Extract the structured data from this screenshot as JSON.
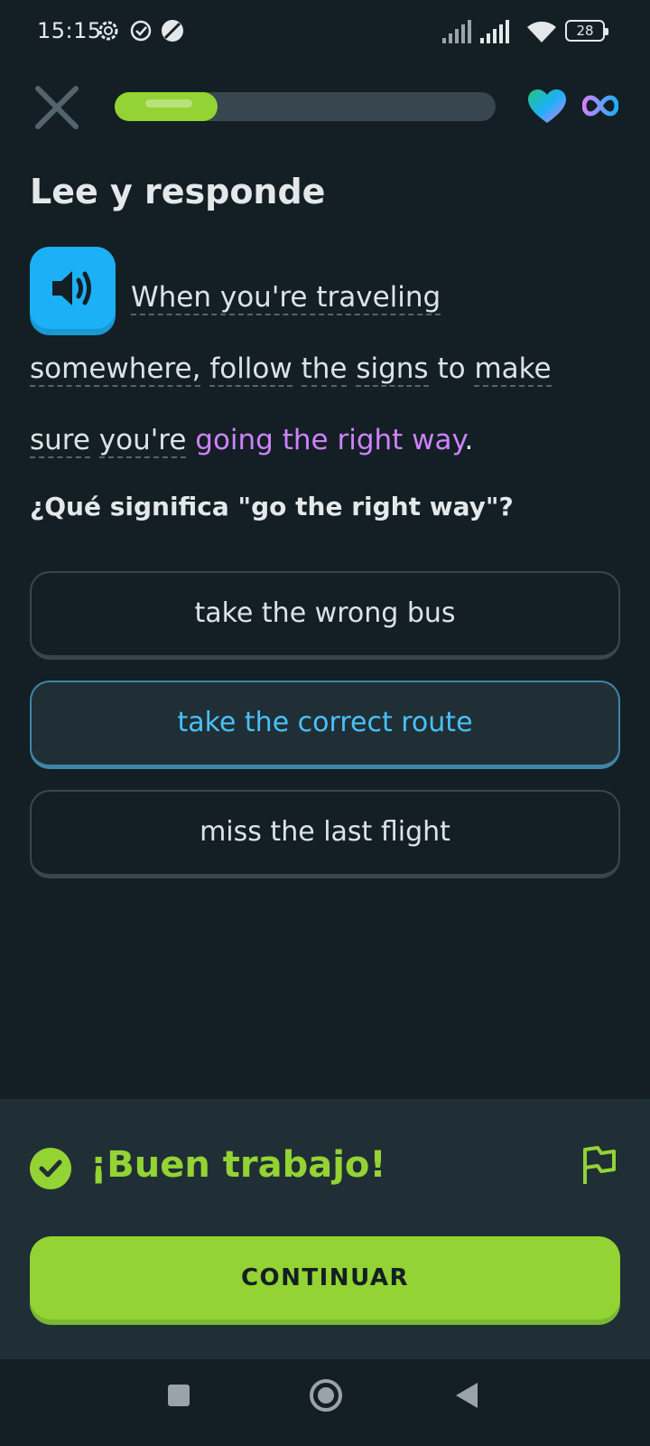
{
  "status_bar": {
    "time": "15:15",
    "battery": "28",
    "icons": [
      "gear-icon",
      "check-circle-icon",
      "dnd-icon",
      "signal-icon",
      "signal-icon",
      "wifi-icon",
      "battery-icon"
    ]
  },
  "header": {
    "close_icon": "close-icon",
    "progress": 0.27,
    "heart_icon": "heart-icon",
    "infinity_icon": "infinity-icon"
  },
  "exercise": {
    "title": "Lee y responde",
    "passage": {
      "line1": "When you're traveling somewhere,",
      "w1": "follow",
      "w2": "the",
      "w3": "signs",
      "w4": "to",
      "w5": "make",
      "w6": "sure",
      "w7": "you're",
      "hl1": "going",
      "hl2": "the right way",
      "end": "."
    },
    "question": "¿Qué significa \"go the right way\"?",
    "options": [
      {
        "label": "take the wrong bus",
        "selected": false
      },
      {
        "label": "take the correct route",
        "selected": true
      },
      {
        "label": "miss the last flight",
        "selected": false
      }
    ]
  },
  "feedback": {
    "title": "¡Buen trabajo!",
    "continue_label": "CONTINUAR"
  },
  "colors": {
    "background": "#131f24",
    "accent_green": "#93d333",
    "accent_blue": "#1cb0f6",
    "highlight_purple": "#ce82ff",
    "panel": "#202f36"
  }
}
